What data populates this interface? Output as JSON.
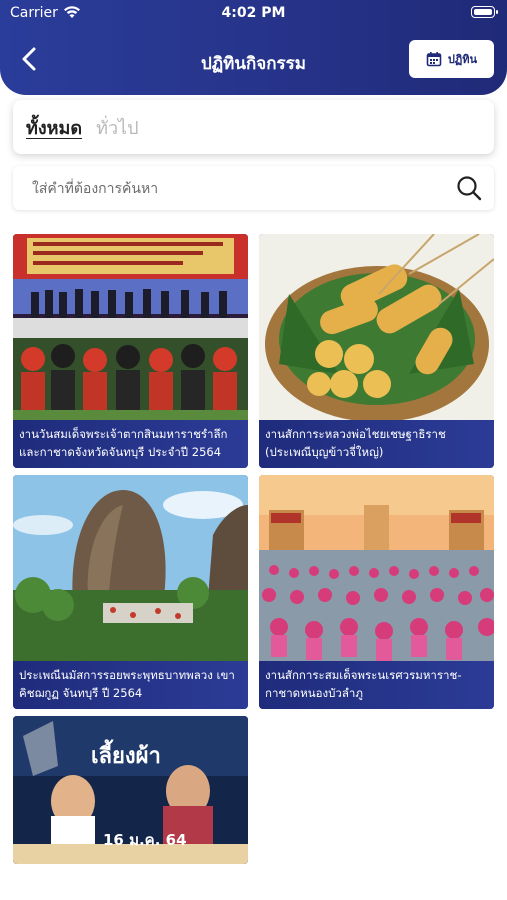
{
  "status_bar": {
    "carrier": "Carrier",
    "time": "4:02 PM"
  },
  "header": {
    "title": "ปฏิทินกิจกรรม",
    "calendar_button": "ปฏิทิน"
  },
  "tabs": [
    {
      "label": "ทั้งหมด",
      "active": true
    },
    {
      "label": "ทั่วไป",
      "active": false
    }
  ],
  "search": {
    "placeholder": "ใส่คำที่ต้องการค้นหา"
  },
  "events": [
    {
      "line1": "งานวันสมเด็จพระเจ้าตากสินมหาราชรำลึก",
      "line2": "และกาชาดจังหวัดจันทบุรี ประจำปี 2564"
    },
    {
      "line1": "งานสักการะหลวงพ่อไชยเชษฐาธิราช",
      "line2": "(ประเพณีบุญข้าวจี่ใหญ่)"
    },
    {
      "line1": "ประเพณีนมัสการรอยพระพุทธบาทพลวง เขา",
      "line2": "คิชฌกูฏ จันทบุรี ปี 2564"
    },
    {
      "line1": "งานสักการะสมเด็จพระนเรศวรมหาราช-",
      "line2": "กาชาดหนองบัวลำภู"
    },
    {
      "poster_title": "เลี้ยงผ้า",
      "poster_date": "16 ม.ค. 64"
    }
  ],
  "colors": {
    "header_blue": "#27348b",
    "caption_blue": "#1f2c7c"
  }
}
